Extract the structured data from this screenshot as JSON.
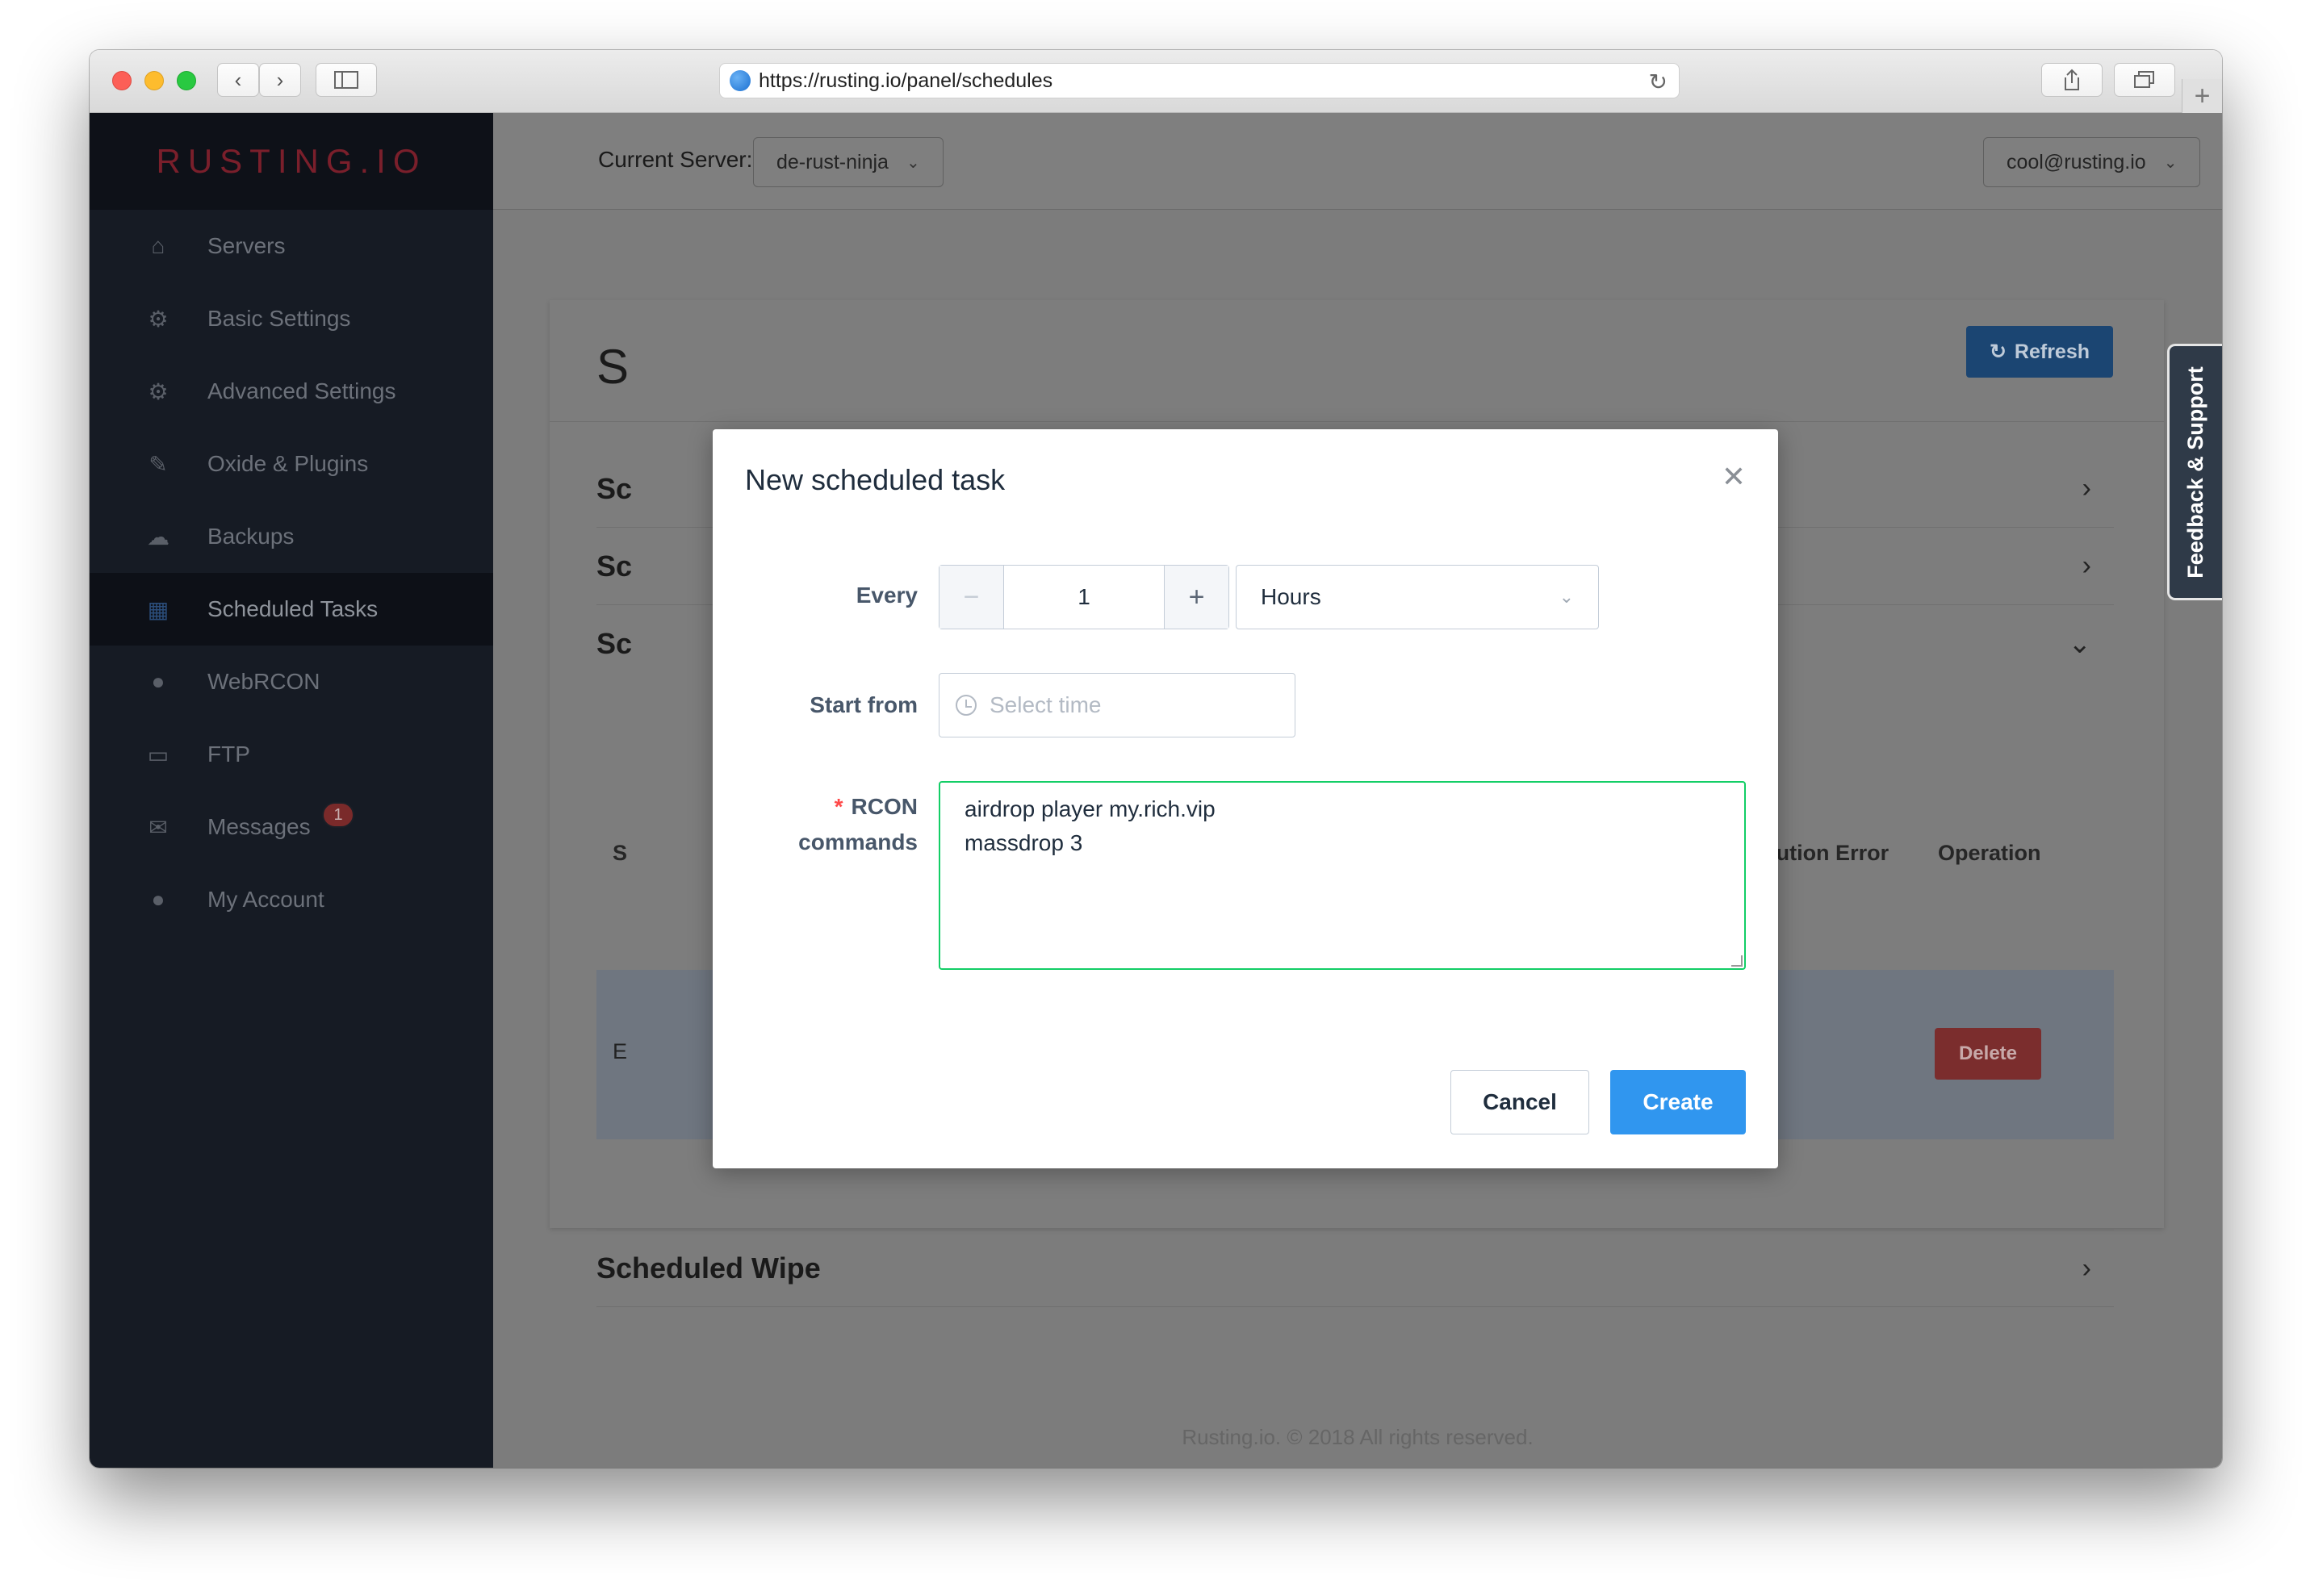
{
  "browser": {
    "url": "https://rusting.io/panel/schedules",
    "back_icon": "chevron-left-icon",
    "forward_icon": "chevron-right-icon",
    "sidebar_icon": "sidebar-toggle-icon",
    "reload_icon": "reload-icon",
    "share_icon": "share-icon",
    "tabs_icon": "tabs-icon",
    "new_tab_icon": "plus-icon"
  },
  "sidebar": {
    "logo": "RUSTING.IO",
    "items": [
      {
        "label": "Servers",
        "icon": "home-icon"
      },
      {
        "label": "Basic Settings",
        "icon": "gear-icon"
      },
      {
        "label": "Advanced Settings",
        "icon": "gears-icon"
      },
      {
        "label": "Oxide & Plugins",
        "icon": "plug-icon"
      },
      {
        "label": "Backups",
        "icon": "cloud-icon"
      },
      {
        "label": "Scheduled Tasks",
        "icon": "calendar-icon",
        "active": true
      },
      {
        "label": "WebRCON",
        "icon": "globe-icon"
      },
      {
        "label": "FTP",
        "icon": "folder-icon"
      },
      {
        "label": "Messages",
        "icon": "envelope-icon",
        "badge": "1"
      },
      {
        "label": "My Account",
        "icon": "user-icon"
      }
    ]
  },
  "topbar": {
    "current_server_label": "Current Server:",
    "server": "de-rust-ninja",
    "user": "cool@rusting.io"
  },
  "card": {
    "title": "S",
    "refresh_label": "Refresh",
    "rows": [
      "Sc",
      "Sc",
      "Sc"
    ],
    "columns": [
      "S",
      "ast Execution Error",
      "Operation"
    ],
    "task_row_cell": "E",
    "delete_label": "Delete",
    "wipe_title": "Scheduled Wipe"
  },
  "feedback_tab": "Feedback & Support",
  "footer": "Rusting.io. © 2018 All rights reserved.",
  "modal": {
    "title": "New scheduled task",
    "every_label": "Every",
    "every_value": "1",
    "unit": "Hours",
    "start_label": "Start from",
    "start_placeholder": "Select time",
    "rcon_label_1": "RCON",
    "rcon_label_2": "commands",
    "rcon_required": "*",
    "rcon_commands": "airdrop player my.rich.vip\nmassdrop 3",
    "cancel_label": "Cancel",
    "create_label": "Create"
  },
  "colors": {
    "sidebar_bg": "#161b24",
    "primary": "#3096ef",
    "success_border": "#13ce66",
    "danger": "#ff4949"
  }
}
